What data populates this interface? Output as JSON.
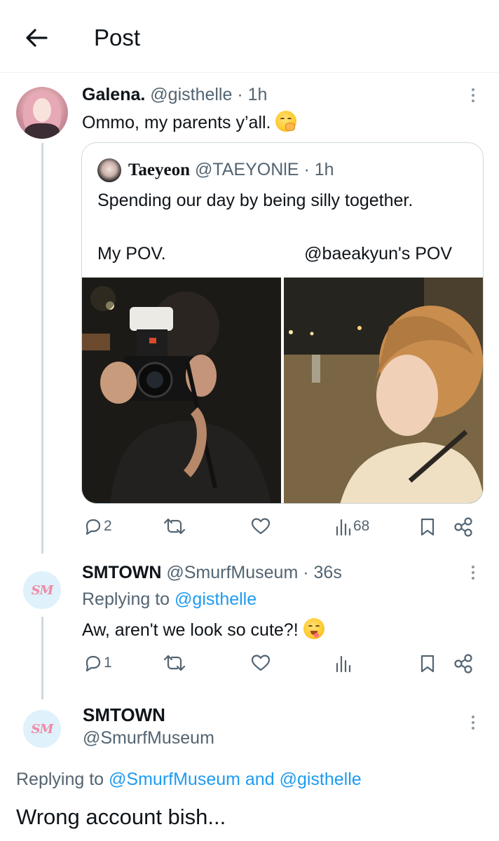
{
  "header": {
    "title": "Post"
  },
  "main_tweet": {
    "display_name": "Galena.",
    "handle": "@gisthelle",
    "separator": "·",
    "time": "1h",
    "text": "Ommo, my parents y’all.",
    "emoji": "face-with-hand-over-mouth",
    "quote": {
      "display_name": "Taeyeon",
      "handle": "@TAEYONlE",
      "separator": "·",
      "time": "1h",
      "text": "Spending our day by being silly together.",
      "pov_left": "My POV.",
      "pov_right": "@baeakyun's POV"
    },
    "actions": {
      "replies": "2",
      "retweets": "",
      "likes": "",
      "views": "68"
    }
  },
  "reply_1": {
    "display_name": "SMTOWN",
    "handle": "@SmurfMuseum",
    "separator": "·",
    "time": "36s",
    "replying_label": "Replying to",
    "replying_handle": "@gisthelle",
    "text": "Aw, aren't we look so cute?!",
    "emoji": "face-savoring-food",
    "avatar_text": "SM",
    "actions": {
      "replies": "1",
      "retweets": "",
      "likes": "",
      "views": ""
    }
  },
  "focused_reply": {
    "display_name": "SMTOWN",
    "handle": "@SmurfMuseum",
    "avatar_text": "SM",
    "replying_label": "Replying to",
    "replying_handle_1": "@SmurfMuseum",
    "replying_and": "and",
    "replying_handle_2": "@gisthelle",
    "text": "Wrong account bish..."
  },
  "colors": {
    "accent": "#1d9bf0",
    "muted_text": "#536471",
    "thread_line": "#cfd9de",
    "border": "#cfd9de"
  }
}
